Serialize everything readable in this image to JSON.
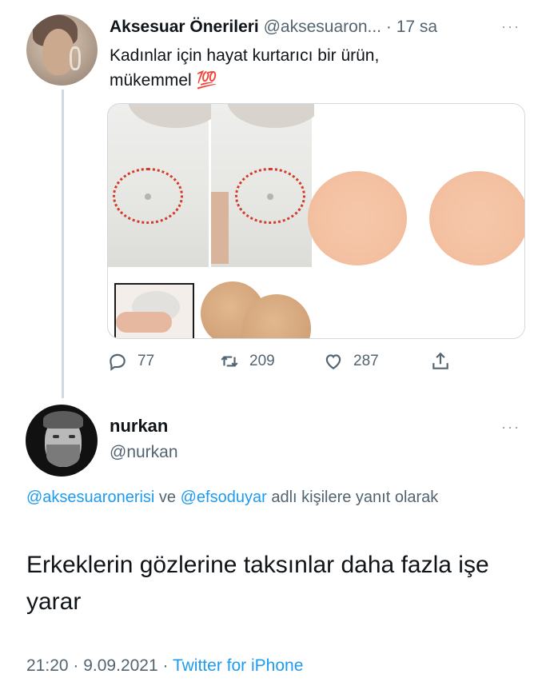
{
  "tweet1": {
    "name": "Aksesuar Önerileri",
    "handle": "@aksesuaron...",
    "separator": "·",
    "time": "17 sa",
    "more": "···",
    "text_line1": "Kadınlar için hayat kurtarıcı bir ürün,",
    "text_line2": "mükemmel 💯",
    "actions": {
      "reply_count": "77",
      "retweet_count": "209",
      "like_count": "287"
    }
  },
  "tweet2": {
    "name": "nurkan",
    "handle": "@nurkan",
    "more": "···",
    "reply_to": {
      "mention1": "@aksesuaronerisi",
      "connector": " ve ",
      "mention2": "@efsoduyar",
      "suffix": " adlı kişilere yanıt olarak"
    },
    "text": "Erkeklerin gözlerine taksınlar daha fazla işe yarar",
    "time": "21:20",
    "date_sep": " · ",
    "date": "9.09.2021",
    "source_sep": " · ",
    "source": "Twitter for iPhone"
  },
  "colors": {
    "link": "#1d9bf0",
    "secondary_text": "#536471",
    "thread_line": "#cfd9de"
  }
}
